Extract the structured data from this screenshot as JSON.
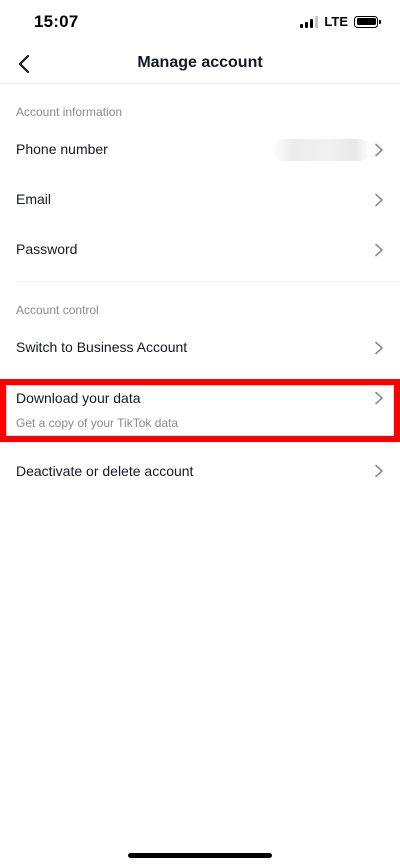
{
  "status_bar": {
    "time": "15:07",
    "network": "LTE",
    "signal_bars": 4,
    "signal_bars_active": 3
  },
  "nav": {
    "title": "Manage account",
    "back_icon": "chevron-left-icon"
  },
  "sections": [
    {
      "header": "Account information",
      "items": [
        {
          "label": "Phone number",
          "value_hidden": true
        },
        {
          "label": "Email"
        },
        {
          "label": "Password"
        }
      ]
    },
    {
      "header": "Account control",
      "items": [
        {
          "label": "Switch to Business Account"
        },
        {
          "label": "Download your data",
          "subtitle": "Get a copy of your TikTok data",
          "highlighted": true
        },
        {
          "label": "Deactivate or delete account"
        }
      ]
    }
  ],
  "colors": {
    "text_primary": "#161823",
    "text_secondary": "#8a8b91",
    "highlight": "#ff0000",
    "chevron": "#8a8b91"
  }
}
